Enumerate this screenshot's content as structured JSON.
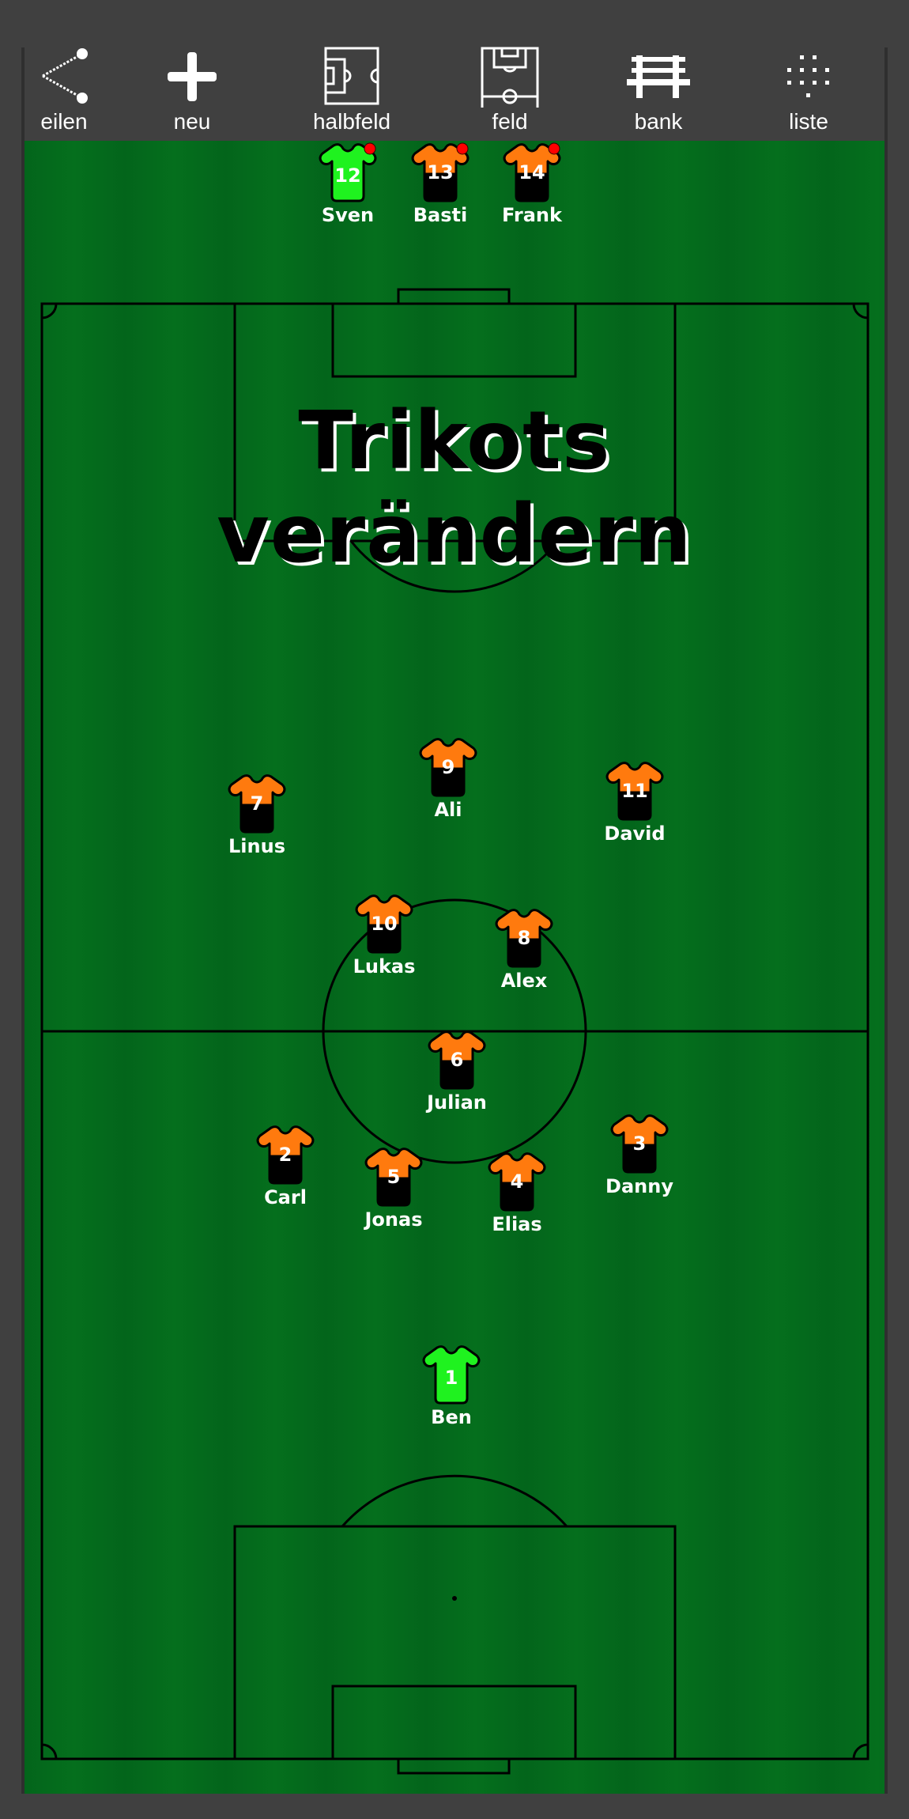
{
  "toolbar": {
    "items": [
      {
        "id": "share",
        "label": "eilen",
        "icon": "share-icon"
      },
      {
        "id": "new",
        "label": "neu",
        "icon": "plus-icon"
      },
      {
        "id": "halffield",
        "label": "halbfeld",
        "icon": "half-field-icon"
      },
      {
        "id": "field",
        "label": "feld",
        "icon": "full-field-icon"
      },
      {
        "id": "bench",
        "label": "bank",
        "icon": "bench-icon"
      },
      {
        "id": "list",
        "label": "liste",
        "icon": "dots-grid-icon"
      }
    ]
  },
  "overlay": {
    "line1": "Trikots",
    "line2": "verändern"
  },
  "colors": {
    "outfield_top": "#ff7a0e",
    "outfield_bottom": "#000000",
    "keeper": "#1ff21f",
    "bench_marker": "#ff0000",
    "pitch_dark": "#03651b",
    "pitch_light": "#056f1d"
  },
  "bench": [
    {
      "number": "12",
      "name": "Sven",
      "kit": "keeper"
    },
    {
      "number": "13",
      "name": "Basti",
      "kit": "outfield"
    },
    {
      "number": "14",
      "name": "Frank",
      "kit": "outfield"
    }
  ],
  "players": [
    {
      "number": "7",
      "name": "Linus",
      "kit": "outfield"
    },
    {
      "number": "9",
      "name": "Ali",
      "kit": "outfield"
    },
    {
      "number": "11",
      "name": "David",
      "kit": "outfield"
    },
    {
      "number": "10",
      "name": "Lukas",
      "kit": "outfield"
    },
    {
      "number": "8",
      "name": "Alex",
      "kit": "outfield"
    },
    {
      "number": "6",
      "name": "Julian",
      "kit": "outfield"
    },
    {
      "number": "2",
      "name": "Carl",
      "kit": "outfield"
    },
    {
      "number": "5",
      "name": "Jonas",
      "kit": "outfield"
    },
    {
      "number": "4",
      "name": "Elias",
      "kit": "outfield"
    },
    {
      "number": "3",
      "name": "Danny",
      "kit": "outfield"
    },
    {
      "number": "1",
      "name": "Ben",
      "kit": "keeper"
    }
  ]
}
